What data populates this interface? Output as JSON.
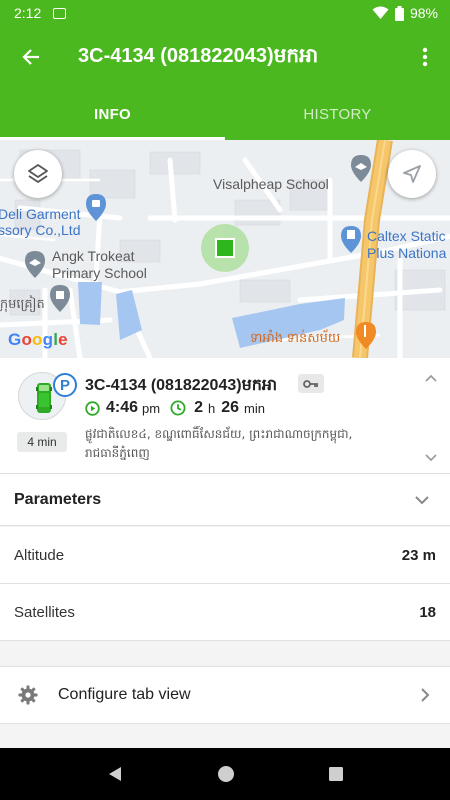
{
  "status_bar": {
    "time": "2:12",
    "battery": "98%"
  },
  "app_bar": {
    "title": "3C-4134 (081822043)មកអា"
  },
  "tabs": [
    {
      "label": "INFO"
    },
    {
      "label": "HISTORY"
    }
  ],
  "map": {
    "labels": {
      "visalpheap": "Visalpheap School",
      "deli_1": "Deli Garment",
      "deli_2": "ssory Co.,Ltd",
      "caltex_1": "Caltex Static",
      "caltex_2": "Plus Nationa",
      "angk_1": "Angk Trokeat",
      "angk_2": "Primary School",
      "left_khmer": "ក្រុមគ្រៀត",
      "restaurant": "ទាអាំង ទាន់សម័យ"
    },
    "logo": "Google",
    "colors": {
      "road": "#ffffff",
      "highway": "#f6c66a",
      "water": "#a6c6f2",
      "marker": "#2fb51d"
    }
  },
  "object": {
    "title": "3C-4134 (081822043)មកអា",
    "parked_badge": "P",
    "ago": "4 min",
    "time_value": "4:46",
    "time_unit": "pm",
    "duration_hours": "2",
    "duration_h_unit": "h",
    "duration_minutes": "26",
    "duration_min_unit": "min",
    "address": "ផ្លូវជាតិលេខ៤, ខណ្ឌពោធិ៍សែនជ័យ, ព្រះរាជាណាចក្រកម្ពុជា, រាជធានីភ្នំពេញ"
  },
  "parameters": {
    "title": "Parameters",
    "rows": [
      {
        "label": "Altitude",
        "value": "23 m"
      },
      {
        "label": "Satellites",
        "value": "18"
      }
    ]
  },
  "config": {
    "label": "Configure tab view"
  },
  "colors": {
    "accent": "#4cb81f",
    "green_icon": "#2eaa27",
    "blue_badge": "#2f7fd6"
  }
}
